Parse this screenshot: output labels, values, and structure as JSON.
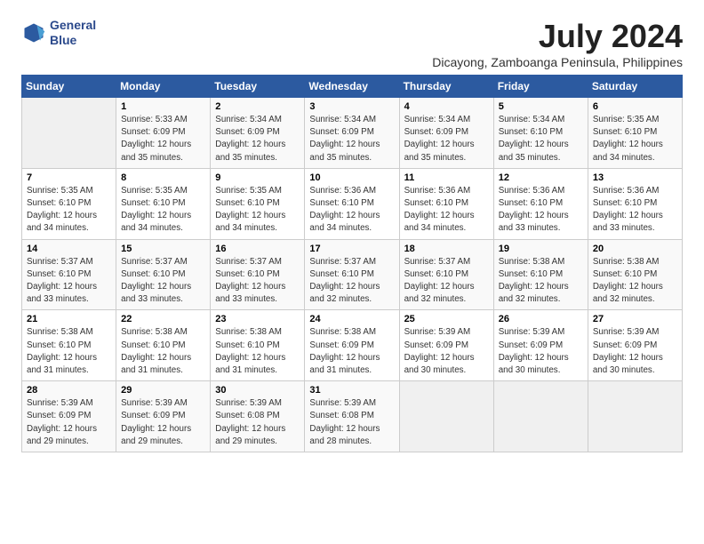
{
  "header": {
    "logo_line1": "General",
    "logo_line2": "Blue",
    "month_year": "July 2024",
    "location": "Dicayong, Zamboanga Peninsula, Philippines"
  },
  "weekdays": [
    "Sunday",
    "Monday",
    "Tuesday",
    "Wednesday",
    "Thursday",
    "Friday",
    "Saturday"
  ],
  "weeks": [
    [
      {
        "day": "",
        "empty": true
      },
      {
        "day": "1",
        "sunrise": "Sunrise: 5:33 AM",
        "sunset": "Sunset: 6:09 PM",
        "daylight": "Daylight: 12 hours and 35 minutes."
      },
      {
        "day": "2",
        "sunrise": "Sunrise: 5:34 AM",
        "sunset": "Sunset: 6:09 PM",
        "daylight": "Daylight: 12 hours and 35 minutes."
      },
      {
        "day": "3",
        "sunrise": "Sunrise: 5:34 AM",
        "sunset": "Sunset: 6:09 PM",
        "daylight": "Daylight: 12 hours and 35 minutes."
      },
      {
        "day": "4",
        "sunrise": "Sunrise: 5:34 AM",
        "sunset": "Sunset: 6:09 PM",
        "daylight": "Daylight: 12 hours and 35 minutes."
      },
      {
        "day": "5",
        "sunrise": "Sunrise: 5:34 AM",
        "sunset": "Sunset: 6:10 PM",
        "daylight": "Daylight: 12 hours and 35 minutes."
      },
      {
        "day": "6",
        "sunrise": "Sunrise: 5:35 AM",
        "sunset": "Sunset: 6:10 PM",
        "daylight": "Daylight: 12 hours and 34 minutes."
      }
    ],
    [
      {
        "day": "7",
        "sunrise": "Sunrise: 5:35 AM",
        "sunset": "Sunset: 6:10 PM",
        "daylight": "Daylight: 12 hours and 34 minutes."
      },
      {
        "day": "8",
        "sunrise": "Sunrise: 5:35 AM",
        "sunset": "Sunset: 6:10 PM",
        "daylight": "Daylight: 12 hours and 34 minutes."
      },
      {
        "day": "9",
        "sunrise": "Sunrise: 5:35 AM",
        "sunset": "Sunset: 6:10 PM",
        "daylight": "Daylight: 12 hours and 34 minutes."
      },
      {
        "day": "10",
        "sunrise": "Sunrise: 5:36 AM",
        "sunset": "Sunset: 6:10 PM",
        "daylight": "Daylight: 12 hours and 34 minutes."
      },
      {
        "day": "11",
        "sunrise": "Sunrise: 5:36 AM",
        "sunset": "Sunset: 6:10 PM",
        "daylight": "Daylight: 12 hours and 34 minutes."
      },
      {
        "day": "12",
        "sunrise": "Sunrise: 5:36 AM",
        "sunset": "Sunset: 6:10 PM",
        "daylight": "Daylight: 12 hours and 33 minutes."
      },
      {
        "day": "13",
        "sunrise": "Sunrise: 5:36 AM",
        "sunset": "Sunset: 6:10 PM",
        "daylight": "Daylight: 12 hours and 33 minutes."
      }
    ],
    [
      {
        "day": "14",
        "sunrise": "Sunrise: 5:37 AM",
        "sunset": "Sunset: 6:10 PM",
        "daylight": "Daylight: 12 hours and 33 minutes."
      },
      {
        "day": "15",
        "sunrise": "Sunrise: 5:37 AM",
        "sunset": "Sunset: 6:10 PM",
        "daylight": "Daylight: 12 hours and 33 minutes."
      },
      {
        "day": "16",
        "sunrise": "Sunrise: 5:37 AM",
        "sunset": "Sunset: 6:10 PM",
        "daylight": "Daylight: 12 hours and 33 minutes."
      },
      {
        "day": "17",
        "sunrise": "Sunrise: 5:37 AM",
        "sunset": "Sunset: 6:10 PM",
        "daylight": "Daylight: 12 hours and 32 minutes."
      },
      {
        "day": "18",
        "sunrise": "Sunrise: 5:37 AM",
        "sunset": "Sunset: 6:10 PM",
        "daylight": "Daylight: 12 hours and 32 minutes."
      },
      {
        "day": "19",
        "sunrise": "Sunrise: 5:38 AM",
        "sunset": "Sunset: 6:10 PM",
        "daylight": "Daylight: 12 hours and 32 minutes."
      },
      {
        "day": "20",
        "sunrise": "Sunrise: 5:38 AM",
        "sunset": "Sunset: 6:10 PM",
        "daylight": "Daylight: 12 hours and 32 minutes."
      }
    ],
    [
      {
        "day": "21",
        "sunrise": "Sunrise: 5:38 AM",
        "sunset": "Sunset: 6:10 PM",
        "daylight": "Daylight: 12 hours and 31 minutes."
      },
      {
        "day": "22",
        "sunrise": "Sunrise: 5:38 AM",
        "sunset": "Sunset: 6:10 PM",
        "daylight": "Daylight: 12 hours and 31 minutes."
      },
      {
        "day": "23",
        "sunrise": "Sunrise: 5:38 AM",
        "sunset": "Sunset: 6:10 PM",
        "daylight": "Daylight: 12 hours and 31 minutes."
      },
      {
        "day": "24",
        "sunrise": "Sunrise: 5:38 AM",
        "sunset": "Sunset: 6:09 PM",
        "daylight": "Daylight: 12 hours and 31 minutes."
      },
      {
        "day": "25",
        "sunrise": "Sunrise: 5:39 AM",
        "sunset": "Sunset: 6:09 PM",
        "daylight": "Daylight: 12 hours and 30 minutes."
      },
      {
        "day": "26",
        "sunrise": "Sunrise: 5:39 AM",
        "sunset": "Sunset: 6:09 PM",
        "daylight": "Daylight: 12 hours and 30 minutes."
      },
      {
        "day": "27",
        "sunrise": "Sunrise: 5:39 AM",
        "sunset": "Sunset: 6:09 PM",
        "daylight": "Daylight: 12 hours and 30 minutes."
      }
    ],
    [
      {
        "day": "28",
        "sunrise": "Sunrise: 5:39 AM",
        "sunset": "Sunset: 6:09 PM",
        "daylight": "Daylight: 12 hours and 29 minutes."
      },
      {
        "day": "29",
        "sunrise": "Sunrise: 5:39 AM",
        "sunset": "Sunset: 6:09 PM",
        "daylight": "Daylight: 12 hours and 29 minutes."
      },
      {
        "day": "30",
        "sunrise": "Sunrise: 5:39 AM",
        "sunset": "Sunset: 6:08 PM",
        "daylight": "Daylight: 12 hours and 29 minutes."
      },
      {
        "day": "31",
        "sunrise": "Sunrise: 5:39 AM",
        "sunset": "Sunset: 6:08 PM",
        "daylight": "Daylight: 12 hours and 28 minutes."
      },
      {
        "day": "",
        "empty": true
      },
      {
        "day": "",
        "empty": true
      },
      {
        "day": "",
        "empty": true
      }
    ]
  ]
}
